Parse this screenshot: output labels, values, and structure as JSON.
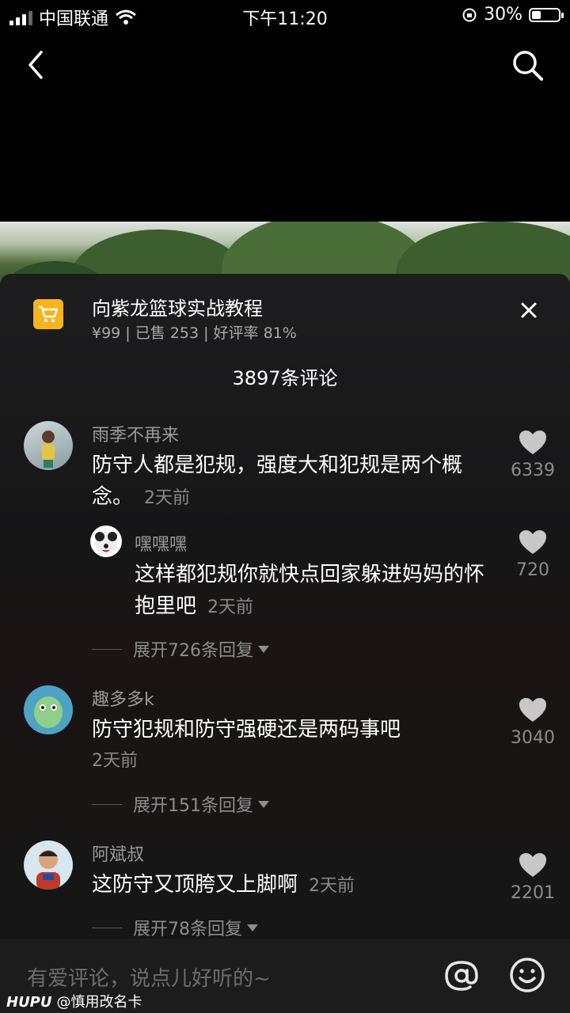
{
  "status_bar": {
    "carrier": "中国联通",
    "time": "下午11:20",
    "battery": "30%",
    "battery_level": 0.3
  },
  "product": {
    "title": "向紫龙篮球实战教程",
    "meta": "¥99 | 已售 253 | 好评率 81%"
  },
  "comment_count": "3897条评论",
  "comments": [
    {
      "name": "雨季不再来",
      "text": "防守人都是犯规，强度大和犯规是两个概念。",
      "time": "2天前",
      "likes": "6339"
    },
    {
      "name": "嘿嘿嘿",
      "text": "这样都犯规你就快点回家躲进妈妈的怀抱里吧",
      "time": "2天前",
      "likes": "720"
    },
    {
      "name": "趣多多k",
      "text": "防守犯规和防守强硬还是两码事吧",
      "time": "2天前",
      "likes": "3040"
    },
    {
      "name": "阿斌叔",
      "text": "这防守又顶胯又上脚啊",
      "time": "2天前",
      "likes": "2201"
    }
  ],
  "expand_labels": [
    "展开726条回复",
    "展开151条回复",
    "展开78条回复"
  ],
  "input": {
    "placeholder": "有爱评论，说点儿好听的~"
  },
  "watermark": {
    "brand": "HUPU",
    "user": "@慎用改名卡"
  },
  "icons": [
    "back-icon",
    "search-icon",
    "cart-icon",
    "close-icon",
    "heart-icon",
    "at-icon",
    "emoji-icon"
  ],
  "colors": {
    "accent": "#f6b51e",
    "sheet": "#1d1d1f"
  }
}
